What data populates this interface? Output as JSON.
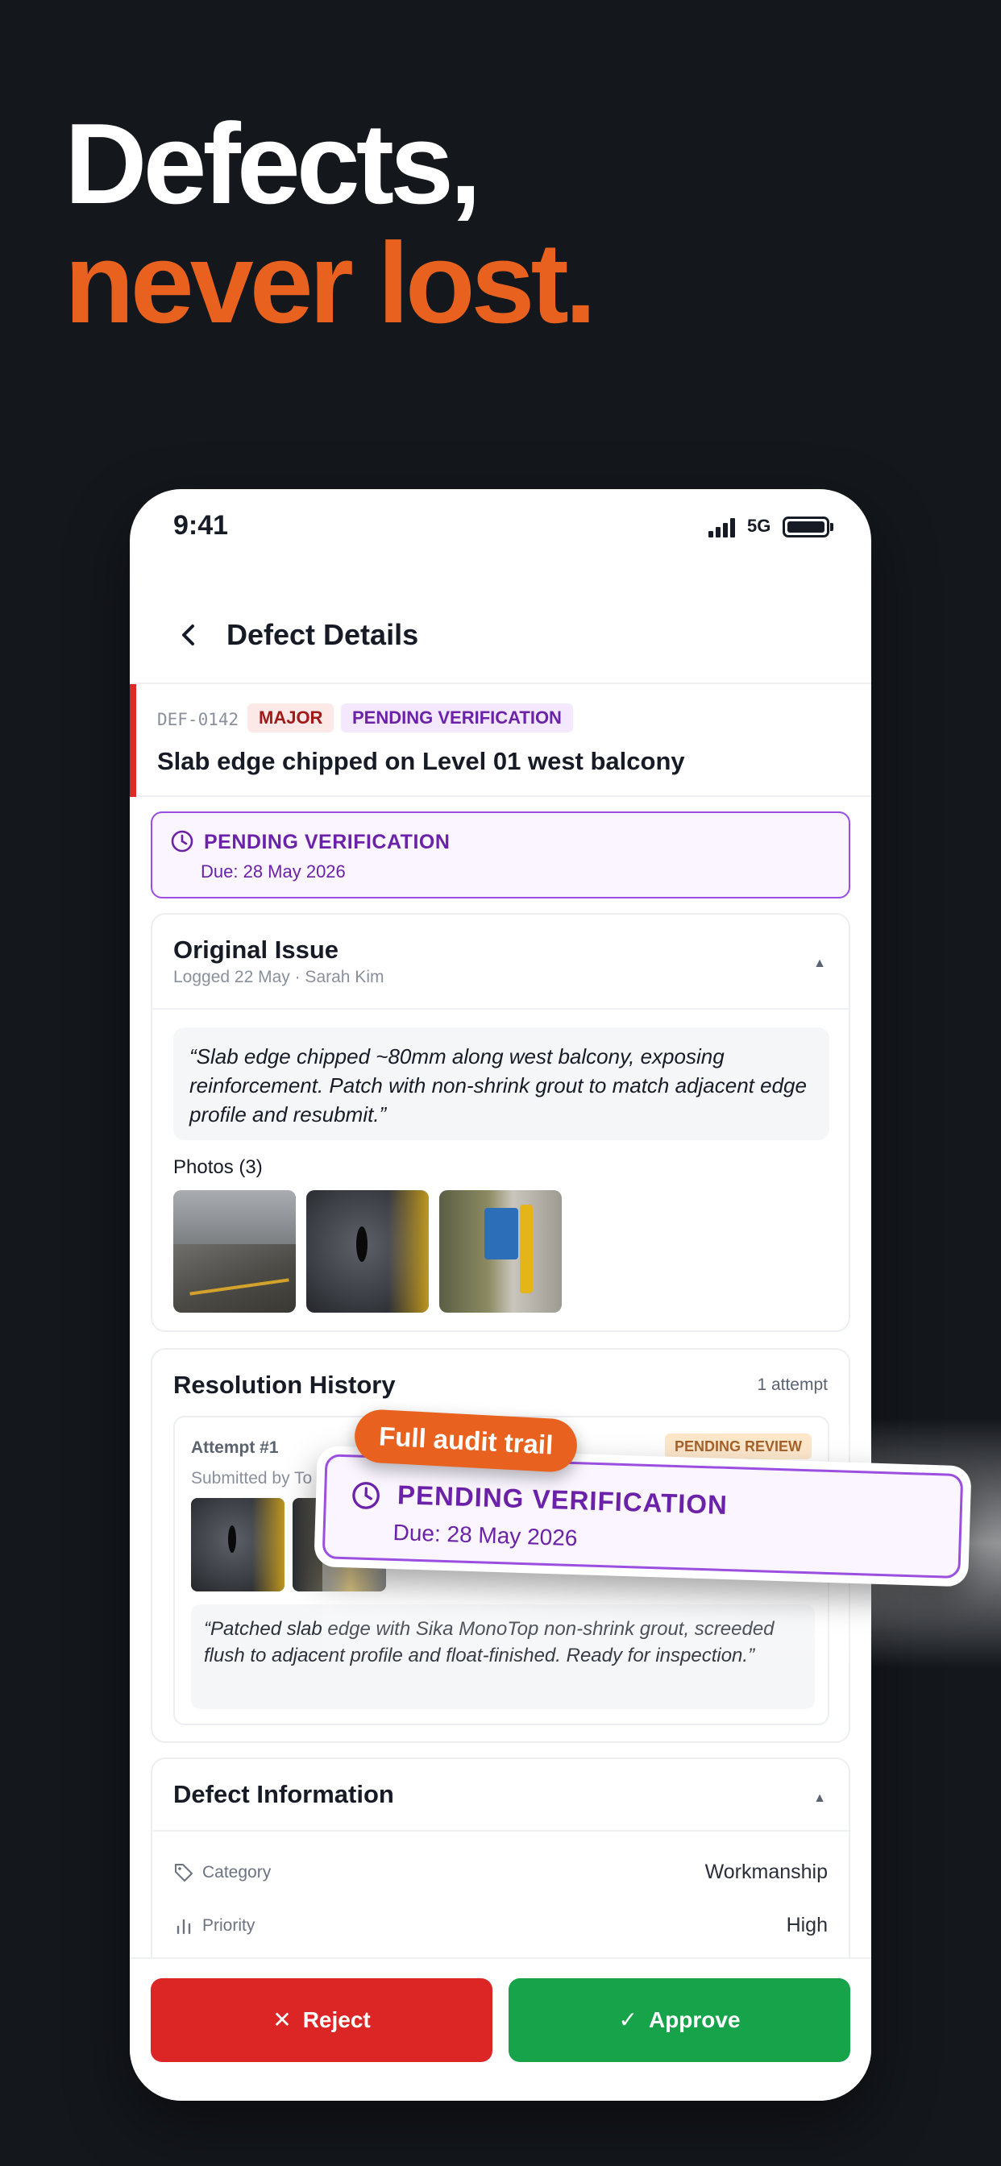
{
  "hero": {
    "line1": "Defects,",
    "line2": "never lost."
  },
  "status_bar": {
    "time": "9:41",
    "network": "5G"
  },
  "nav": {
    "title": "Defect Details"
  },
  "defect": {
    "code": "DEF-0142",
    "severity": "MAJOR",
    "status_badge": "PENDING VERIFICATION",
    "title": "Slab edge chipped on Level 01 west balcony"
  },
  "verification": {
    "status": "PENDING VERIFICATION",
    "due": "Due: 28 May 2026"
  },
  "original_issue": {
    "title": "Original Issue",
    "meta": "Logged 22 May · Sarah Kim",
    "quote": "“Slab edge chipped ~80mm along west balcony, exposing reinforcement. Patch with non-shrink grout to match adjacent edge profile and resubmit.”",
    "photos_label": "Photos (3)"
  },
  "resolution": {
    "title": "Resolution History",
    "count": "1 attempt",
    "attempt_title": "Attempt #1",
    "attempt_sub": "Submitted by To",
    "attempt_status": "PENDING REVIEW",
    "note": "“Patched slab edge with Sika MonoTop non-shrink grout, screeded flush to adjacent profile and float-finished. Ready for inspection.”"
  },
  "info": {
    "title": "Defect Information",
    "rows": [
      {
        "label": "Category",
        "value": "Workmanship"
      },
      {
        "label": "Priority",
        "value": "High"
      }
    ]
  },
  "actions": {
    "reject": "Reject",
    "approve": "Approve"
  },
  "callout": {
    "pill": "Full audit trail",
    "status": "PENDING VERIFICATION",
    "due": "Due: 28 May 2026"
  },
  "colors": {
    "accent": "#e8611e",
    "major": "#dc2a2a",
    "pending": "#6b21a8",
    "reject": "#dc2626",
    "approve": "#16a34a"
  },
  "icons": [
    "back-chevron-icon",
    "clock-icon",
    "tag-icon",
    "bar-chart-icon",
    "close-icon",
    "check-icon"
  ]
}
